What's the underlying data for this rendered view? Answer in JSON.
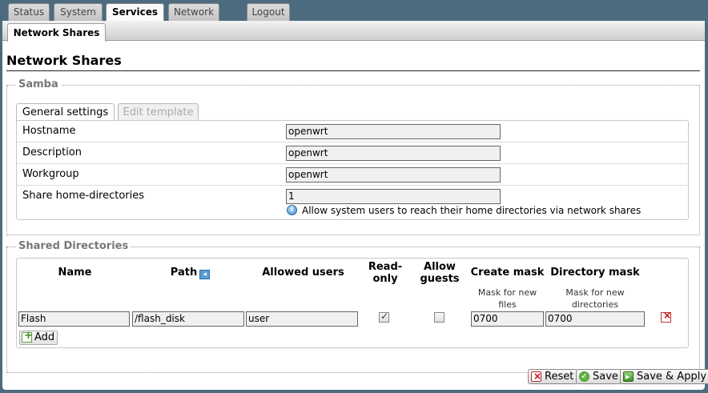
{
  "topnav": {
    "tabs": [
      {
        "label": "Status"
      },
      {
        "label": "System"
      },
      {
        "label": "Services"
      },
      {
        "label": "Network"
      },
      {
        "label": "Logout"
      }
    ]
  },
  "subnav": {
    "active_tab": "Network Shares"
  },
  "page": {
    "title": "Network Shares"
  },
  "samba": {
    "legend": "Samba",
    "tabs": {
      "general": "General settings",
      "template": "Edit template"
    },
    "fields": [
      {
        "label": "Hostname",
        "value": "openwrt"
      },
      {
        "label": "Description",
        "value": "openwrt"
      },
      {
        "label": "Workgroup",
        "value": "openwrt"
      },
      {
        "label": "Share home-directories",
        "value": "1"
      }
    ],
    "home_hint": "Allow system users to reach their home directories via network shares"
  },
  "shared": {
    "legend": "Shared Directories",
    "headers": {
      "name": "Name",
      "path": "Path",
      "allowed_users": "Allowed users",
      "read_only_1": "Read-",
      "read_only_2": "only",
      "allow_guests_1": "Allow",
      "allow_guests_2": "guests",
      "create_mask": "Create mask",
      "dir_mask": "Directory mask"
    },
    "subheaders": {
      "create_mask_1": "Mask for new",
      "create_mask_2": "files",
      "dir_mask_1": "Mask for new",
      "dir_mask_2": "directories"
    },
    "rows": [
      {
        "name": "Flash",
        "path": "/flash_disk",
        "users": "user",
        "read_only": true,
        "guests": false,
        "create_mask": "0700",
        "dir_mask": "0700"
      }
    ],
    "add_label": "Add"
  },
  "actions": {
    "reset": "Reset",
    "save": "Save",
    "save_apply": "Save & Apply"
  }
}
